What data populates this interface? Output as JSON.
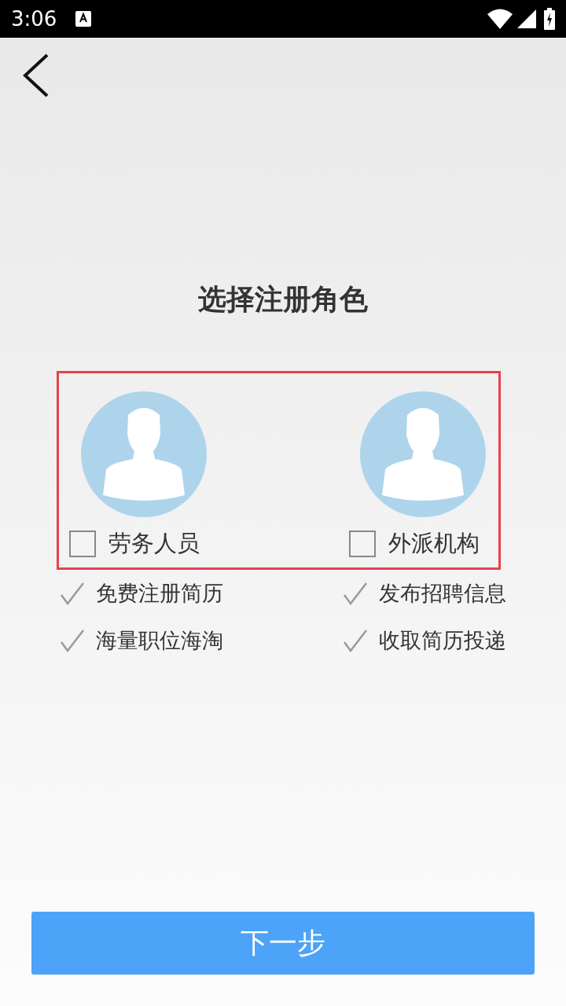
{
  "status_bar": {
    "time": "3:06"
  },
  "title": "选择注册角色",
  "roles": [
    {
      "label": "劳务人员",
      "checked": false,
      "features": [
        "免费注册简历",
        "海量职位海淘"
      ]
    },
    {
      "label": "外派机构",
      "checked": false,
      "features": [
        "发布招聘信息",
        "收取简历投递"
      ]
    }
  ],
  "button": "下一步"
}
